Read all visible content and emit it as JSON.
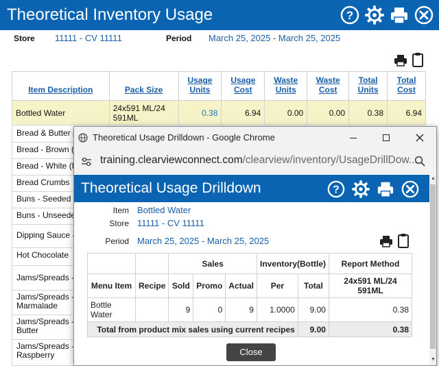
{
  "header": {
    "title": "Theoretical Inventory Usage"
  },
  "filters": {
    "store_label": "Store",
    "store_value": "11111 - CV 11111",
    "period_label": "Period",
    "period_value": "March 25, 2025 - March 25, 2025"
  },
  "table": {
    "columns": [
      {
        "line1": "Item Description",
        "line2": ""
      },
      {
        "line1": "Pack Size",
        "line2": ""
      },
      {
        "line1": "Usage",
        "line2": "Units"
      },
      {
        "line1": "Usage",
        "line2": "Cost"
      },
      {
        "line1": "Waste",
        "line2": "Units"
      },
      {
        "line1": "Waste",
        "line2": "Cost"
      },
      {
        "line1": "Total",
        "line2": "Units"
      },
      {
        "line1": "Total",
        "line2": "Cost"
      }
    ],
    "first_row": {
      "item": "Bottled Water",
      "pack": "24x591 ML/24 591ML",
      "usage_units": "0.38",
      "usage_cost": "6.94",
      "waste_units": "0.00",
      "waste_cost": "0.00",
      "total_units": "0.38",
      "total_cost": "6.94"
    },
    "rows": [
      "Bread & Butter p",
      "Bread - Brown (fr",
      "Bread - White (Fr",
      "Bread Crumbs",
      "Buns - Seeded",
      "Buns - Unseeded",
      "Dipping Sauce -",
      "Hot Chocolate",
      "Jams/Spreads - I",
      "Jams/Spreads -",
      "Marmalade",
      "Jams/Spreads -",
      "Butter",
      "Jams/Spreads -",
      "Raspberry"
    ]
  },
  "popup": {
    "window_title": "Theoretical Usage Drilldown - Google Chrome",
    "url_host": "training.clearviewconnect.com",
    "url_path": "/clearview/inventory/UsageDrillDow...",
    "title": "Theoretical Usage Drilldown",
    "item_label": "Item",
    "item_value": "Bottled Water",
    "store_label": "Store",
    "store_value": "11111 - CV 11111",
    "period_label": "Period",
    "period_value": "March 25, 2025 - March 25, 2025",
    "group_sales": "Sales",
    "group_inventory": "Inventory(Bottle)",
    "group_report": "Report Method",
    "col_menu_item": "Menu Item",
    "col_recipe": "Recipe",
    "col_sold": "Sold",
    "col_promo": "Promo",
    "col_actual": "Actual",
    "col_per": "Per",
    "col_total": "Total",
    "col_report": "24x591 ML/24 591ML",
    "row": {
      "menu_item": "Bottle Water",
      "recipe": "",
      "sold": "9",
      "promo": "0",
      "actual": "9",
      "per": "1.0000",
      "total": "9.00",
      "report": "0.38"
    },
    "total_label": "Total from product mix sales using current recipes",
    "total_inventory": "9.00",
    "total_report": "0.38",
    "close_label": "Close"
  },
  "colors": {
    "brand_blue": "#0a64b2",
    "link_blue": "#1a5ea8",
    "highlight_row": "#f7f3c9"
  }
}
